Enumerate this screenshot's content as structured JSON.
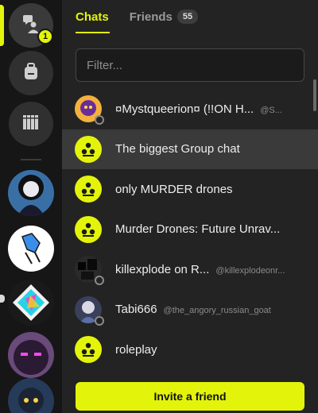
{
  "rail": {
    "notification_count": "1",
    "icons": [
      "chat-people-icon",
      "backpack-icon",
      "library-icon"
    ],
    "accent_color": "#e3f40a"
  },
  "tabs": {
    "chats": "Chats",
    "friends": "Friends",
    "friends_count": "55"
  },
  "filter": {
    "placeholder": "Filter..."
  },
  "chats": [
    {
      "name": "¤Mystqueerion¤ (!!ON H...",
      "handle": "@S...",
      "type": "user"
    },
    {
      "name": "The biggest Group chat",
      "handle": "",
      "type": "group",
      "selected": true
    },
    {
      "name": "only MURDER drones",
      "handle": "",
      "type": "group"
    },
    {
      "name": "Murder Drones: Future Unrav...",
      "handle": "",
      "type": "group"
    },
    {
      "name": "killexplode on R...",
      "handle": "@killexplodeonr...",
      "type": "user"
    },
    {
      "name": "Tabi666",
      "handle": "@the_angory_russian_goat",
      "type": "user"
    },
    {
      "name": "roleplay",
      "handle": "",
      "type": "group"
    }
  ],
  "invite": {
    "label": "Invite a friend"
  }
}
